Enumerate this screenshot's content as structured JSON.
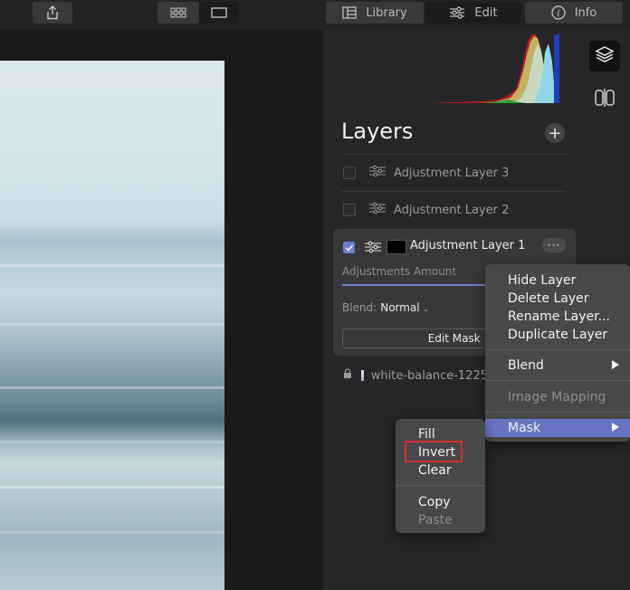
{
  "toolbar": {
    "share_icon": "share-icon",
    "grid_view_icon": "grid-view-icon",
    "single_view_icon": "single-view-icon",
    "library_label": "Library",
    "edit_label": "Edit",
    "info_label": "Info"
  },
  "panel": {
    "title": "Layers",
    "add_label": "+",
    "layers": [
      {
        "name": "Adjustment Layer 3",
        "checked": false
      },
      {
        "name": "Adjustment Layer 2",
        "checked": false
      }
    ],
    "active_layer": {
      "name": "Adjustment Layer 1",
      "checked": true,
      "more_label": "···",
      "amount_label": "Adjustments Amount",
      "blend_label": "Blend:",
      "blend_value": "Normal",
      "edit_mask_label": "Edit Mask"
    },
    "base_layer": {
      "name": "white-balance-1225"
    }
  },
  "context_menu": {
    "items": [
      {
        "label": "Hide Layer"
      },
      {
        "label": "Delete Layer"
      },
      {
        "label": "Rename Layer..."
      },
      {
        "label": "Duplicate Layer"
      },
      {
        "label": "Blend"
      },
      {
        "label": "Image Mapping",
        "disabled": true
      },
      {
        "label": "Mask",
        "highlighted": true
      }
    ]
  },
  "mask_submenu": {
    "items": [
      {
        "label": "Fill"
      },
      {
        "label": "Invert"
      },
      {
        "label": "Clear"
      },
      {
        "label": "Copy"
      },
      {
        "label": "Paste",
        "disabled": true
      }
    ]
  },
  "colors": {
    "accent": "#6a74c2",
    "checkbox_active": "#6b7fd1",
    "highlight_box": "#d43030"
  }
}
